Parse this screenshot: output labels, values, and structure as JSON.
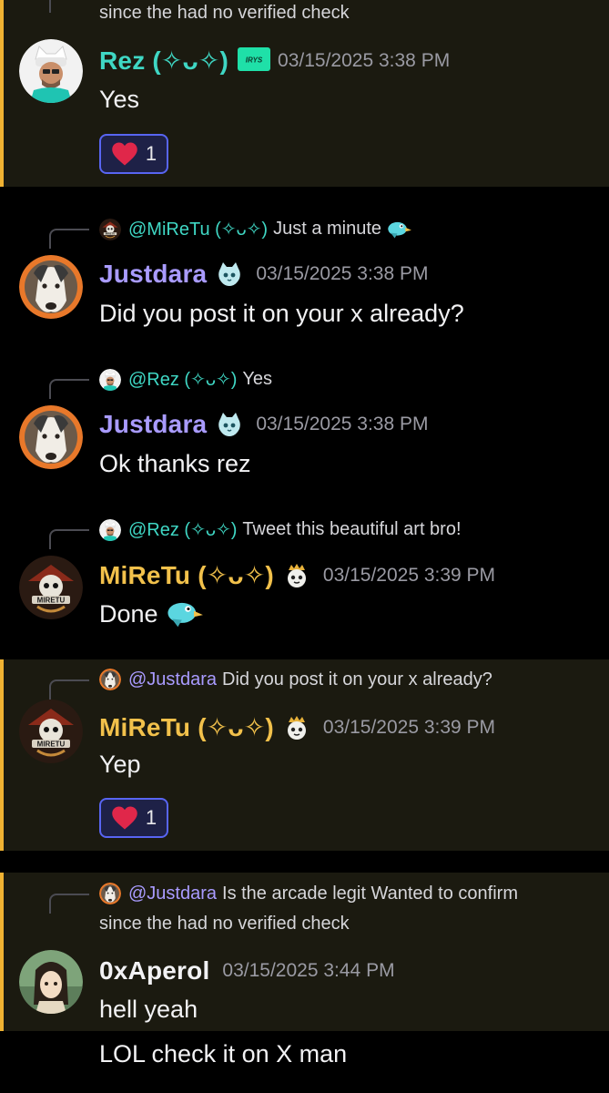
{
  "top_continuation": "since the  had no verified check",
  "messages": [
    {
      "author": "Rez (✧ᴗ✧)",
      "time": "03/15/2025 3:38 PM",
      "badge_text": "IRYS",
      "content": "Yes",
      "reaction": {
        "emoji": "heart",
        "count": "1"
      }
    },
    {
      "reply_mention": "@MiReTu (✧ᴗ✧)",
      "reply_text": "Just a minute",
      "author": "Justdara",
      "time": "03/15/2025 3:38 PM",
      "content": "Did you post it on your x already?"
    },
    {
      "reply_mention": "@Rez (✧ᴗ✧)",
      "reply_text": "Yes",
      "author": "Justdara",
      "time": "03/15/2025 3:38 PM",
      "content": "Ok thanks rez"
    },
    {
      "reply_mention": "@Rez (✧ᴗ✧)",
      "reply_text": "Tweet this beautiful art bro!",
      "author": "MiReTu (✧ᴗ✧)",
      "time": "03/15/2025 3:39 PM",
      "content": "Done"
    },
    {
      "reply_mention": "@Justdara",
      "reply_text": "Did you post it on your x already?",
      "author": "MiReTu (✧ᴗ✧)",
      "time": "03/15/2025 3:39 PM",
      "content": "Yep",
      "reaction": {
        "emoji": "heart",
        "count": "1"
      }
    },
    {
      "reply_mention": "@Justdara",
      "reply_text": "Is the arcade legit  Wanted to confirm",
      "reply_text_line2": "since the  had no verified check",
      "author": "0xAperol",
      "time": "03/15/2025 3:44 PM",
      "content": "hell yeah",
      "content2": "LOL check it on X man"
    }
  ],
  "colors": {
    "highlight_band": "#1b1a10",
    "highlight_bar": "#f0b232",
    "teal_name": "#3fd7c4",
    "purple_name": "#a99bff",
    "gold_name": "#f2c14b",
    "reaction_border": "#5865f2"
  },
  "icons": [
    "heart-icon",
    "bird-emoji-icon",
    "cat-badge-icon",
    "crowned-badge-icon",
    "irys-badge-icon"
  ]
}
